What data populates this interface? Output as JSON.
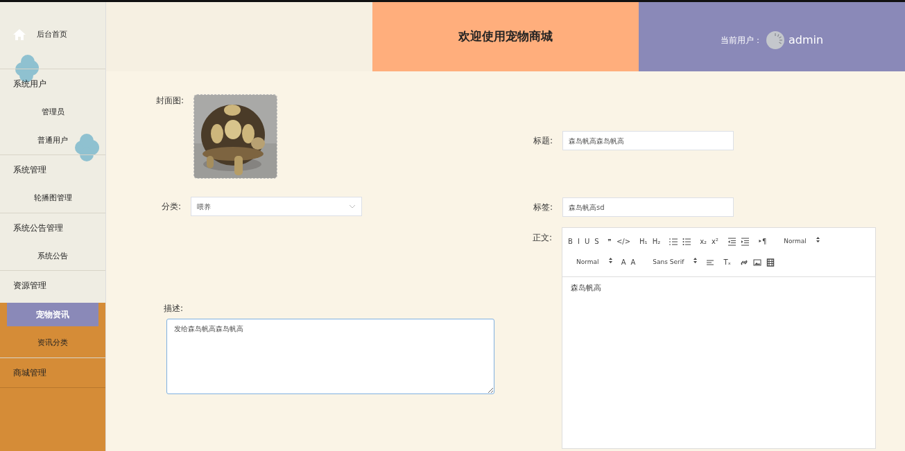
{
  "sidebar": {
    "items": [
      {
        "kind": "home",
        "label": "后台首页",
        "selected": false
      },
      {
        "kind": "group",
        "label": "系统用户",
        "children": [
          {
            "label": "管理员",
            "selected": false
          },
          {
            "label": "普通用户",
            "selected": false
          }
        ]
      },
      {
        "kind": "group",
        "label": "系统管理",
        "children": [
          {
            "label": "轮播图管理",
            "selected": false
          }
        ]
      },
      {
        "kind": "group",
        "label": "系统公告管理",
        "children": [
          {
            "label": "系统公告",
            "selected": false
          }
        ]
      },
      {
        "kind": "group",
        "label": "资源管理",
        "children": [
          {
            "label": "宠物资讯",
            "selected": true
          },
          {
            "label": "资讯分类",
            "selected": false
          }
        ]
      },
      {
        "kind": "group",
        "label": "商城管理"
      }
    ]
  },
  "header": {
    "title": "欢迎使用宠物商城",
    "user_label": "当前用户：",
    "user_name": "admin"
  },
  "form": {
    "cover": {
      "label": "封面图:"
    },
    "title": {
      "label": "标题:",
      "value": "森岛帆高森岛帆高"
    },
    "category": {
      "label": "分类:",
      "value": "喂养"
    },
    "tag": {
      "label": "标签:",
      "value": "森岛帆高sd"
    },
    "body": {
      "label": "正文:",
      "content": "森岛帆高",
      "toolbar_rows": [
        [
          {
            "items": [
              {
                "kind": "text",
                "text": "B"
              },
              {
                "kind": "text",
                "text": "I"
              },
              {
                "kind": "text",
                "text": "U"
              },
              {
                "kind": "text",
                "text": "S"
              }
            ]
          },
          {
            "items": [
              {
                "kind": "text",
                "text": "❞"
              },
              {
                "kind": "text",
                "text": "</>"
              }
            ]
          },
          {
            "items": [
              {
                "kind": "text",
                "text": "H₁"
              },
              {
                "kind": "text",
                "text": "H₂"
              }
            ]
          },
          {
            "items": [
              {
                "kind": "icon"
              },
              {
                "kind": "icon"
              }
            ]
          },
          {
            "items": [
              {
                "kind": "text",
                "text": "x₂"
              },
              {
                "kind": "text",
                "text": "x²"
              }
            ]
          },
          {
            "items": [
              {
                "kind": "icon"
              },
              {
                "kind": "icon"
              }
            ]
          },
          {
            "items": [
              {
                "kind": "text",
                "text": "‣¶"
              }
            ]
          },
          {
            "items": [
              {
                "kind": "picker",
                "text": "Normal"
              }
            ]
          }
        ],
        [
          {
            "items": [
              {
                "kind": "picker",
                "text": "Normal"
              }
            ]
          },
          {
            "items": [
              {
                "kind": "text",
                "text": "A"
              },
              {
                "kind": "text",
                "text": "A"
              }
            ]
          },
          {
            "items": [
              {
                "kind": "picker",
                "text": "Sans Serif"
              }
            ]
          },
          {
            "items": [
              {
                "kind": "icon"
              }
            ]
          },
          {
            "items": [
              {
                "kind": "text",
                "text": "Tₓ"
              }
            ]
          },
          {
            "items": [
              {
                "kind": "icon"
              },
              {
                "kind": "icon"
              },
              {
                "kind": "icon"
              }
            ]
          }
        ]
      ]
    },
    "description": {
      "label": "描述:",
      "value": "发给森岛帆高森岛帆高"
    }
  }
}
